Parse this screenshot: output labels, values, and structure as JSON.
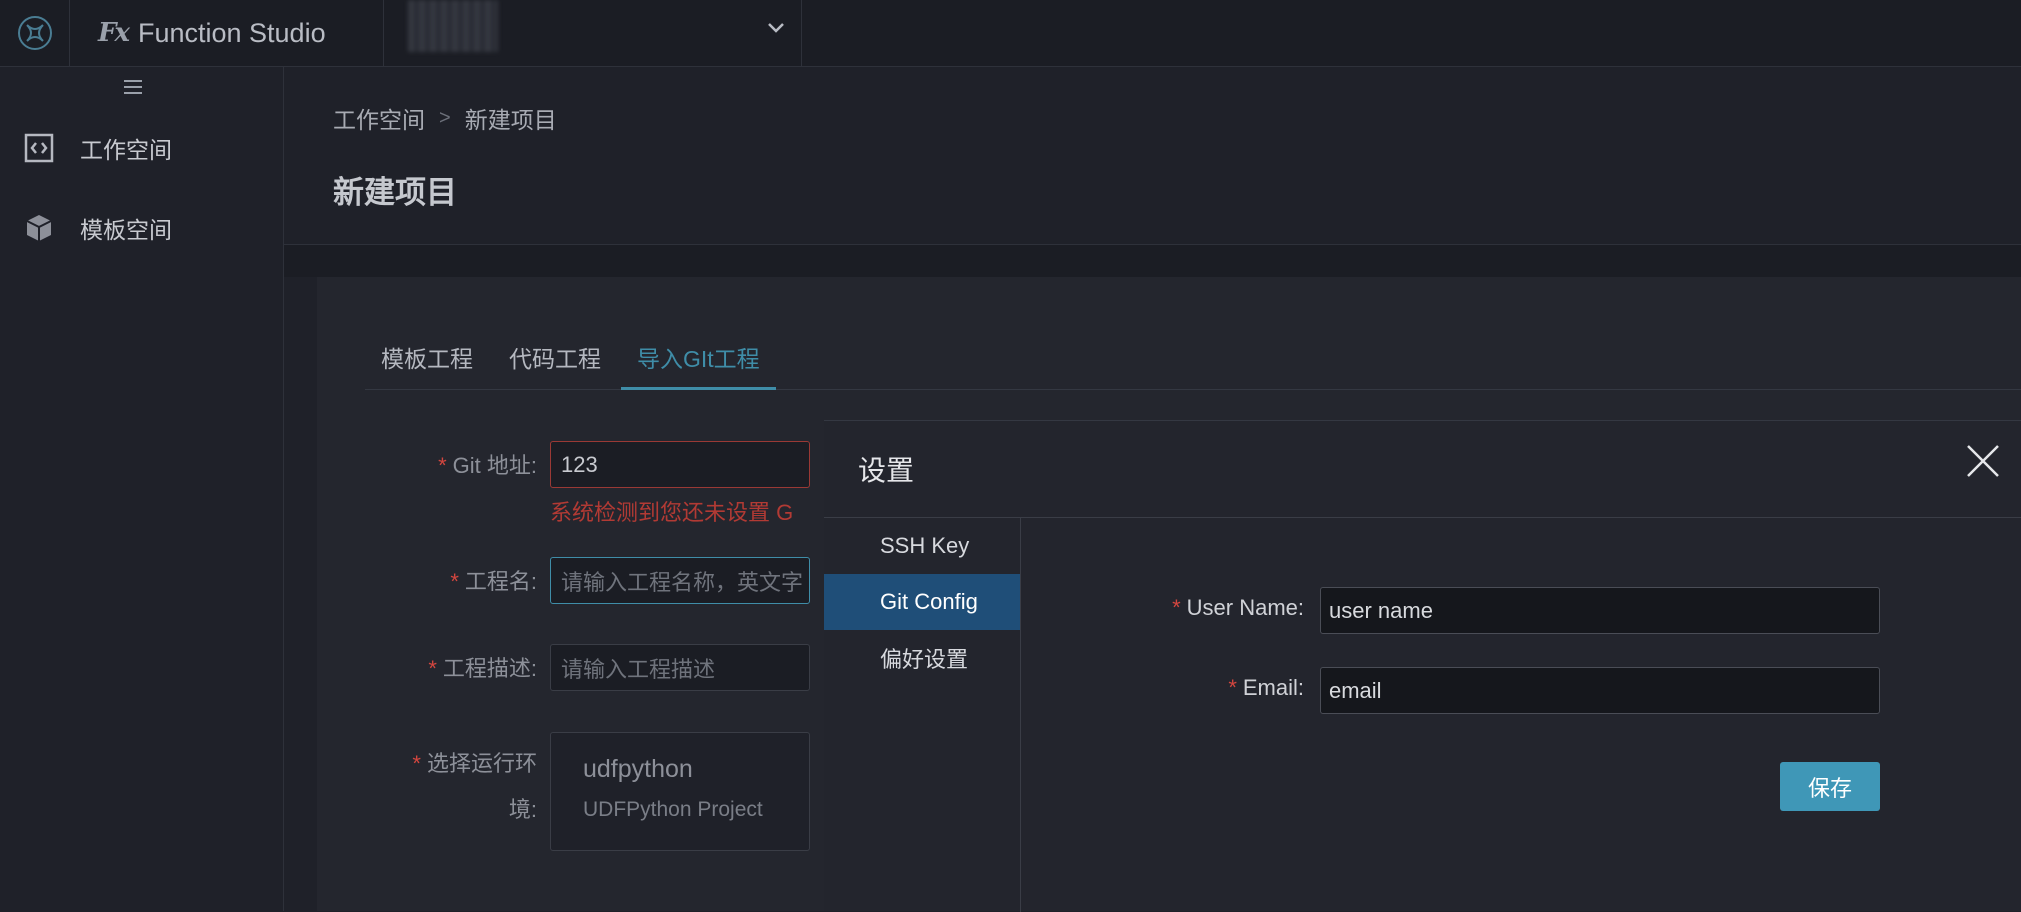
{
  "header": {
    "brand_mark": "Fx",
    "brand_name": "Function Studio"
  },
  "sidebar": {
    "items": [
      {
        "label": "工作空间",
        "icon": "code-bracket-icon"
      },
      {
        "label": "模板空间",
        "icon": "cube-icon"
      }
    ]
  },
  "breadcrumb": {
    "items": [
      "工作空间",
      "新建项目"
    ],
    "separator": ">"
  },
  "page_title": "新建项目",
  "tabs": [
    {
      "label": "模板工程",
      "active": false
    },
    {
      "label": "代码工程",
      "active": false
    },
    {
      "label": "导入GIt工程",
      "active": true
    }
  ],
  "form": {
    "git_address": {
      "label": "Git 地址:",
      "value": "123",
      "error": "系统检测到您还未设置 G"
    },
    "project_name": {
      "label": "工程名:",
      "placeholder": "请输入工程名称，英文字"
    },
    "project_desc": {
      "label": "工程描述:",
      "placeholder": "请输入工程描述"
    },
    "runtime": {
      "label_line1": "选择运行环",
      "label_line2": "境:",
      "name": "udfpython",
      "description": "UDFPython Project"
    }
  },
  "modal": {
    "title": "设置",
    "nav": [
      {
        "label": "SSH Key",
        "active": false
      },
      {
        "label": "Git Config",
        "active": true
      },
      {
        "label": "偏好设置",
        "active": false
      }
    ],
    "user_name": {
      "label": "User Name:",
      "value": "user name"
    },
    "email": {
      "label": "Email:",
      "value": "email"
    },
    "save_label": "保存"
  },
  "colors": {
    "accent": "#3f8da8",
    "primary_button": "#3f97b7",
    "active_nav": "#1f4e78",
    "error": "#d3463f"
  }
}
